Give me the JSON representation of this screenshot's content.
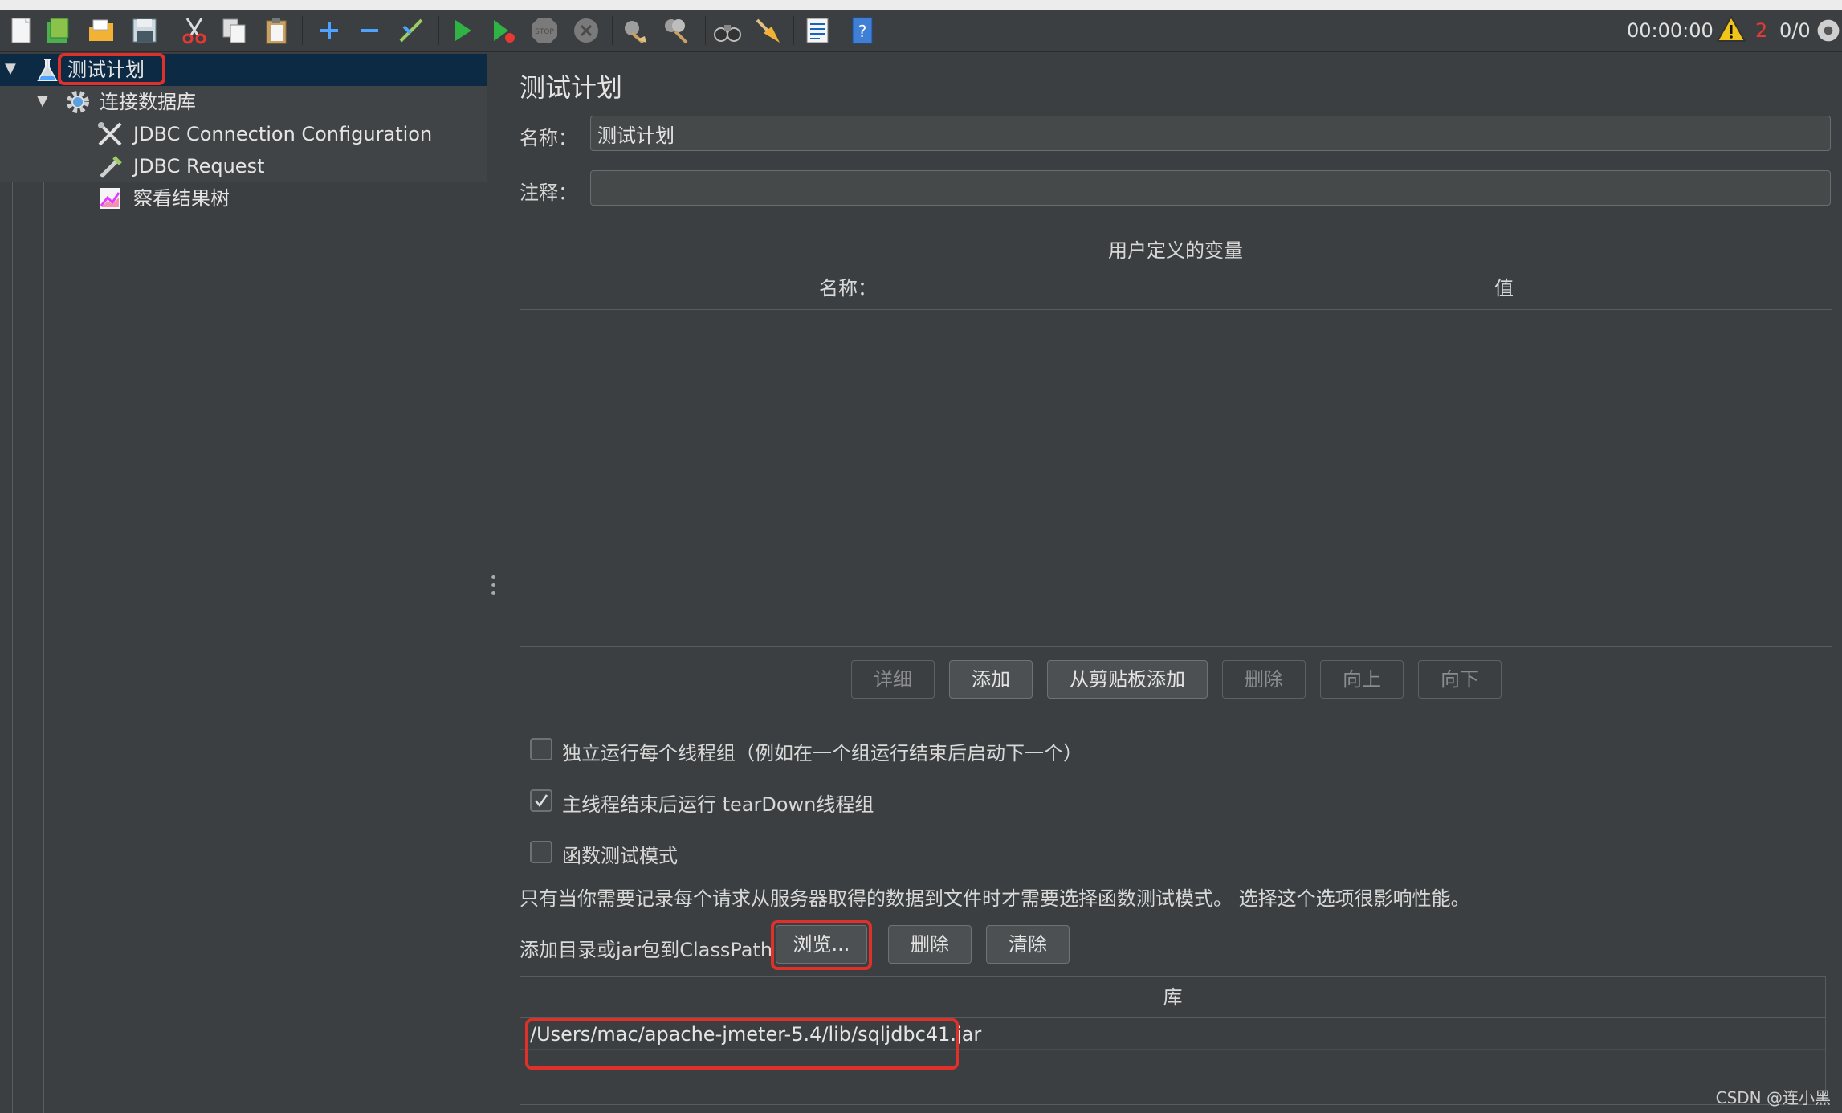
{
  "toolbar": {
    "icons": [
      "new-icon",
      "templates-icon",
      "open-icon",
      "save-icon",
      "cut-icon",
      "copy-icon",
      "paste-icon",
      "expand-icon",
      "collapse-icon",
      "toggle-icon",
      "start-icon",
      "start-no-pause-icon",
      "stop-icon",
      "shutdown-icon",
      "clear-icon",
      "clear-all-icon",
      "search-icon",
      "reset-search-icon",
      "function-helper-icon",
      "help-icon",
      "warning-icon",
      "remote-icon"
    ],
    "timer": "00:00:00",
    "warning_count": "2",
    "threads": "0/0"
  },
  "tree": {
    "items": [
      {
        "label": "测试计划"
      },
      {
        "label": "连接数据库"
      },
      {
        "label": "JDBC Connection Configuration"
      },
      {
        "label": "JDBC Request"
      },
      {
        "label": "察看结果树"
      }
    ]
  },
  "panel": {
    "title": "测试计划",
    "name_label": "名称：",
    "name_value": "测试计划",
    "comment_label": "注释：",
    "comment_value": "",
    "vars_title": "用户定义的变量",
    "vars_columns": [
      "名称：",
      "值"
    ],
    "buttons": {
      "detail": "详细",
      "add": "添加",
      "add_from_clipboard": "从剪贴板添加",
      "delete": "删除",
      "up": "向上",
      "down": "向下"
    },
    "options": {
      "serial_threads": "独立运行每个线程组（例如在一个组运行结束后启动下一个）",
      "teardown": "主线程结束后运行 tearDown线程组",
      "functional_mode": "函数测试模式"
    },
    "functional_note": "只有当你需要记录每个请求从服务器取得的数据到文件时才需要选择函数测试模式。 选择这个选项很影响性能。",
    "classpath_label": "添加目录或jar包到ClassPath",
    "browse": "浏览...",
    "cp_delete": "删除",
    "cp_clear": "清除",
    "lib_header": "库",
    "lib_rows": [
      "/Users/mac/apache-jmeter-5.4/lib/sqljdbc41.jar"
    ]
  },
  "watermark": "CSDN @连小黑",
  "colors": {
    "background": "#3c3f41",
    "selection": "#0d2a45",
    "highlight": "#e0302a",
    "warning": "#f0c419"
  }
}
